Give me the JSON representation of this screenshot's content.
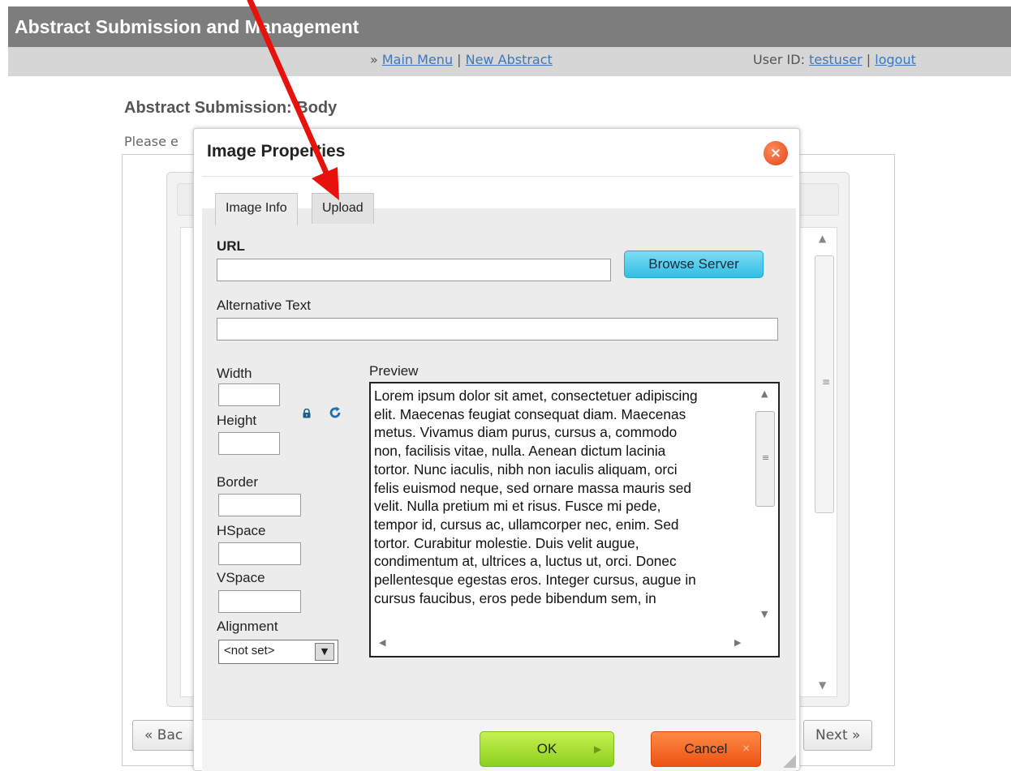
{
  "app": {
    "title": "Abstract Submission and Management"
  },
  "nav": {
    "prefix": "» ",
    "main_menu": "Main Menu",
    "separator": " | ",
    "new_abstract": "New Abstract",
    "user_label": "User ID: ",
    "user_id": "testuser",
    "logout": "logout"
  },
  "page": {
    "title": "Abstract Submission: Body",
    "instructions": "Please e",
    "back_label": "« Bac",
    "next_label": "Next »"
  },
  "dialog": {
    "title": "Image Properties",
    "close_icon": "close-icon",
    "tabs": [
      {
        "label": "Image Info",
        "active": true
      },
      {
        "label": "Upload",
        "active": false
      }
    ],
    "url_label": "URL",
    "url_value": "",
    "browse_label": "Browse Server",
    "alt_label": "Alternative Text",
    "alt_value": "",
    "width_label": "Width",
    "height_label": "Height",
    "border_label": "Border",
    "hspace_label": "HSpace",
    "vspace_label": "VSpace",
    "alignment_label": "Alignment",
    "alignment_value": "<not set>",
    "preview_label": "Preview",
    "preview_lines": [
      "Lorem ipsum dolor sit amet, consectetuer adipiscing",
      "elit. Maecenas feugiat consequat diam. Maecenas",
      "metus. Vivamus diam purus, cursus a, commodo",
      "non, facilisis vitae, nulla. Aenean dictum lacinia",
      "tortor. Nunc iaculis, nibh non iaculis aliquam, orci",
      "felis euismod neque, sed ornare massa mauris sed",
      "velit. Nulla pretium mi et risus. Fusce mi pede,",
      "tempor id, cursus ac, ullamcorper nec, enim. Sed",
      "tortor. Curabitur molestie. Duis velit augue,",
      "condimentum at, ultrices a, luctus ut, orci. Donec",
      "pellentesque egestas eros. Integer cursus, augue in",
      "cursus faucibus, eros pede bibendum sem, in"
    ],
    "ok_label": "OK",
    "cancel_label": "Cancel"
  },
  "colors": {
    "title_bar": "#7d7d7d",
    "nav_bar": "#d6d6d6",
    "link": "#3a78c0",
    "browse_button": "#2fbfe5",
    "ok_button": "#8bd020",
    "cancel_button": "#ec5213",
    "close_button": "#e2441a",
    "annotation_arrow": "#e8120c"
  }
}
